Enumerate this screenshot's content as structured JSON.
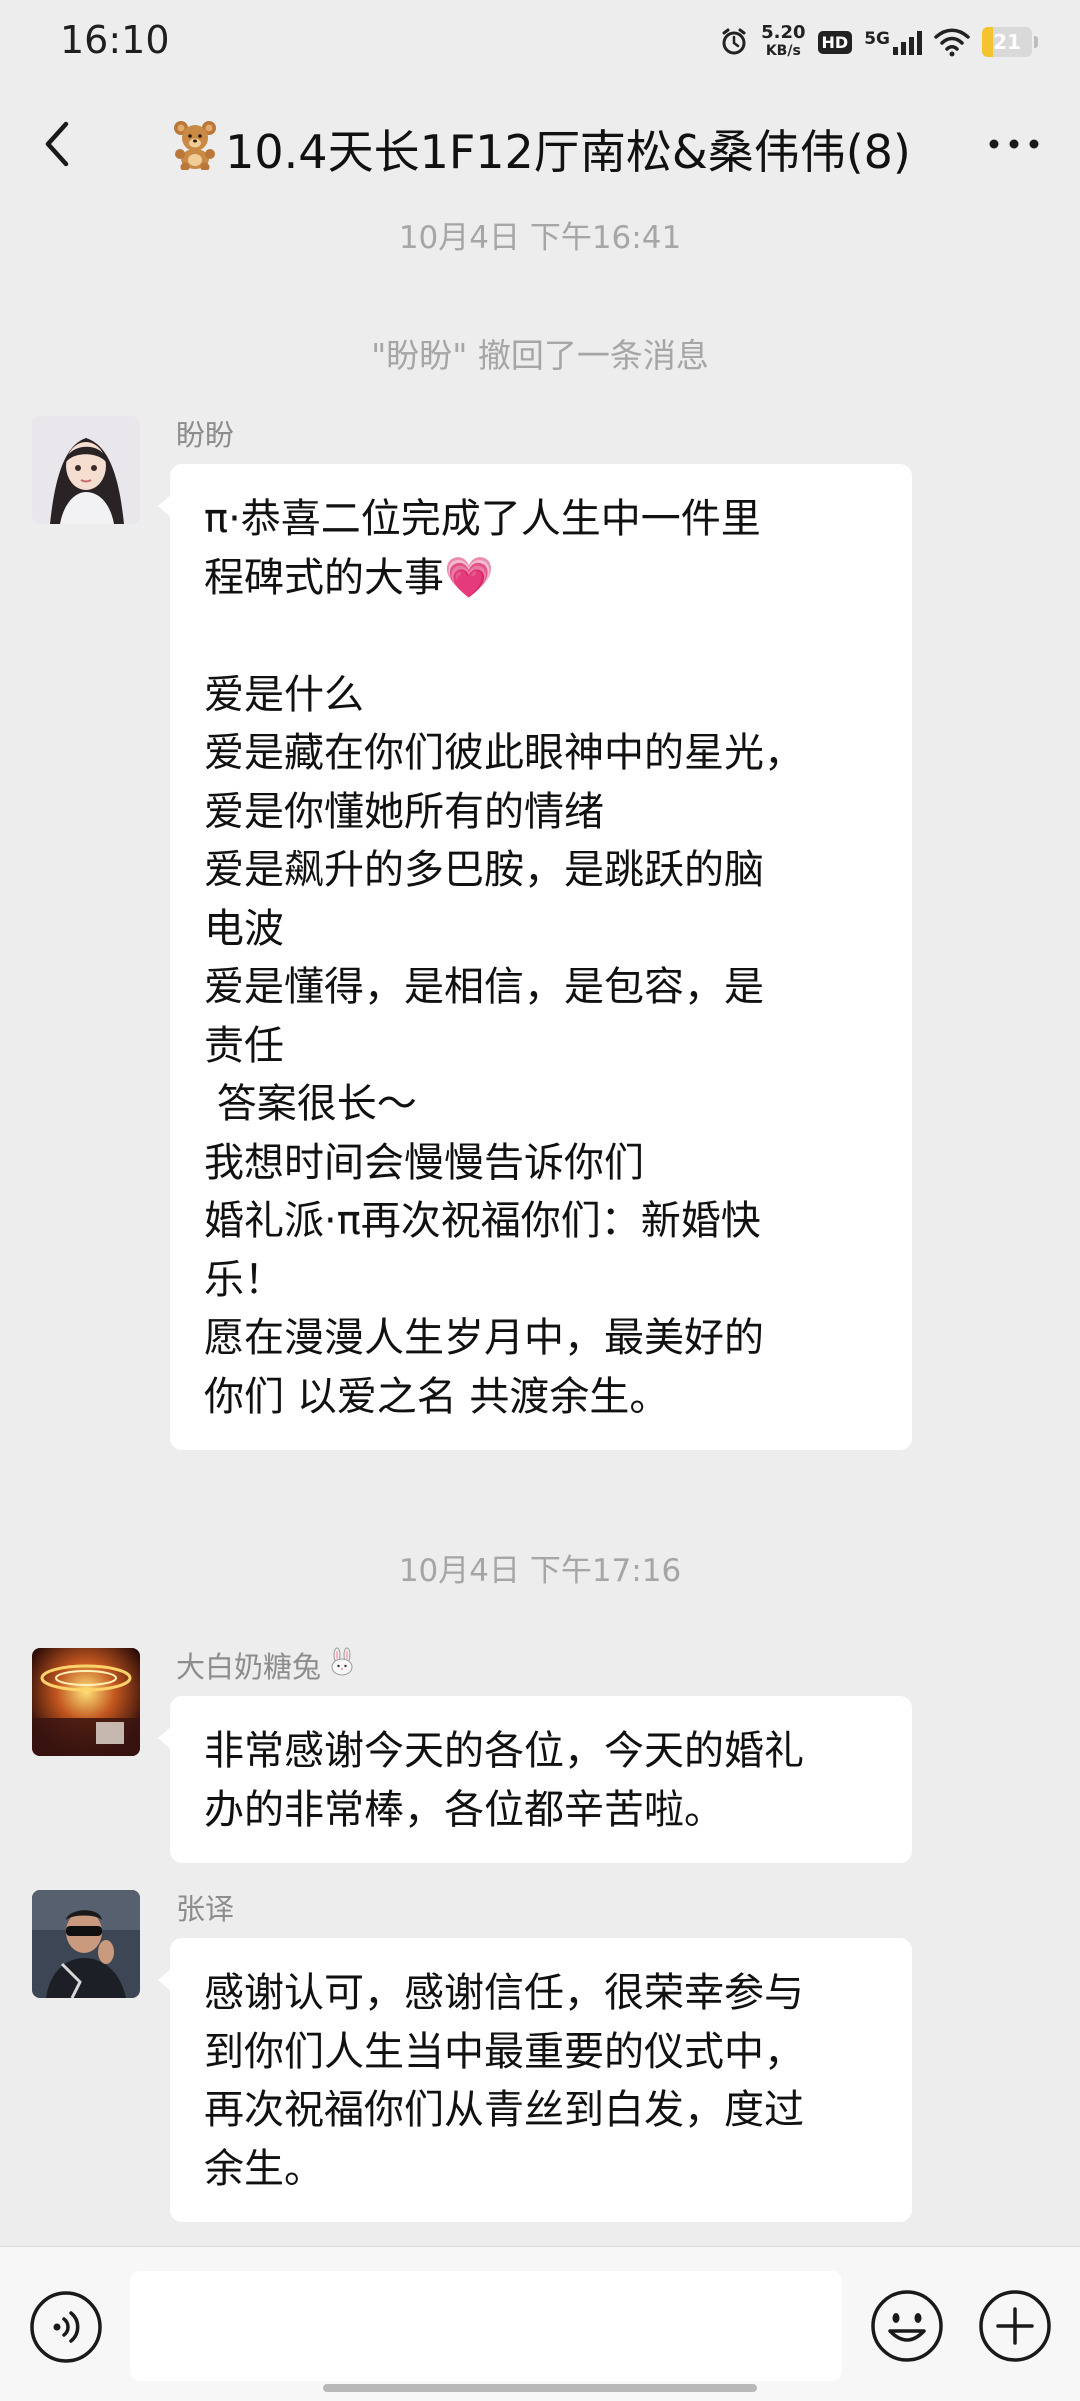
{
  "status_bar": {
    "time": "16:10",
    "net_speed_value": "5.20",
    "net_speed_unit": "KB/s",
    "hd_label": "HD",
    "network_label": "5G",
    "battery_level": "21",
    "battery_color": "#f4c430",
    "icons": [
      "alarm-icon",
      "hd-icon",
      "signal-5g-icon",
      "wifi-icon",
      "battery-icon"
    ]
  },
  "header": {
    "title_text": "10.4天长1F12厅南松&桑伟伟(8)",
    "title_icon": "teddy-bear-icon",
    "back_icon": "chevron-left-icon",
    "more_icon": "more-dots-icon"
  },
  "chat": {
    "timestamp_1": "10月4日 下午16:41",
    "recall_notice": "\"盼盼\" 撤回了一条消息",
    "message_1": {
      "sender": "盼盼",
      "lines": [
        "π·恭喜二位完成了人生中一件里",
        "程碑式的大事💗",
        "",
        "爱是什么",
        "爱是藏在你们彼此眼神中的星光，",
        "爱是你懂她所有的情绪",
        "爱是飙升的多巴胺，是跳跃的脑",
        "电波",
        "爱是懂得，是相信，是包容，是",
        "责任",
        " 答案很长～",
        "我想时间会慢慢告诉你们",
        "婚礼派·π再次祝福你们：新婚快",
        "乐！",
        "愿在漫漫人生岁月中，最美好的",
        "你们 以爱之名 共渡余生。"
      ]
    },
    "timestamp_2": "10月4日 下午17:16",
    "message_2": {
      "sender": "大白奶糖兔",
      "sender_icon": "rabbit-icon",
      "lines": [
        "非常感谢今天的各位，今天的婚礼",
        "办的非常棒，各位都辛苦啦。"
      ]
    },
    "message_3": {
      "sender": "张译",
      "lines": [
        "感谢认可，感谢信任，很荣幸参与",
        "到你们人生当中最重要的仪式中，",
        "再次祝福你们从青丝到白发，度过",
        "余生。"
      ]
    }
  },
  "input_bar": {
    "placeholder": "",
    "voice_icon": "voice-icon",
    "emoji_icon": "emoji-icon",
    "plus_icon": "plus-icon"
  },
  "colors": {
    "background": "#ededed",
    "bubble": "#ffffff",
    "meta_text": "#a6a6a6"
  }
}
